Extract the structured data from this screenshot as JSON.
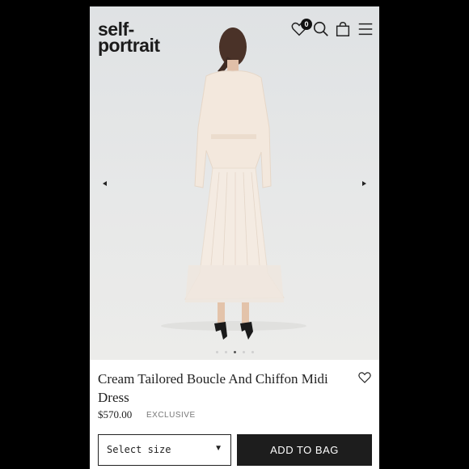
{
  "header": {
    "logo_line1": "self-",
    "logo_line2": "portrait",
    "wishlist_count": "0",
    "icons": [
      "heart-icon",
      "search-icon",
      "shopping-bag-icon",
      "menu-icon"
    ]
  },
  "gallery": {
    "prev_icon": "triangle-left",
    "next_icon": "triangle-right",
    "image_count": 5,
    "active_index": 2
  },
  "product": {
    "name": "Cream Tailored Boucle And Chiffon Midi Dress",
    "price": "$570.00",
    "tag": "EXCLUSIVE",
    "size_select_value": "Select size",
    "add_to_bag_label": "ADD TO BAG"
  },
  "colors": {
    "background": "#000000",
    "button_dark": "#1d1d1d",
    "text": "#222222",
    "dress": "#f1e6dc"
  }
}
